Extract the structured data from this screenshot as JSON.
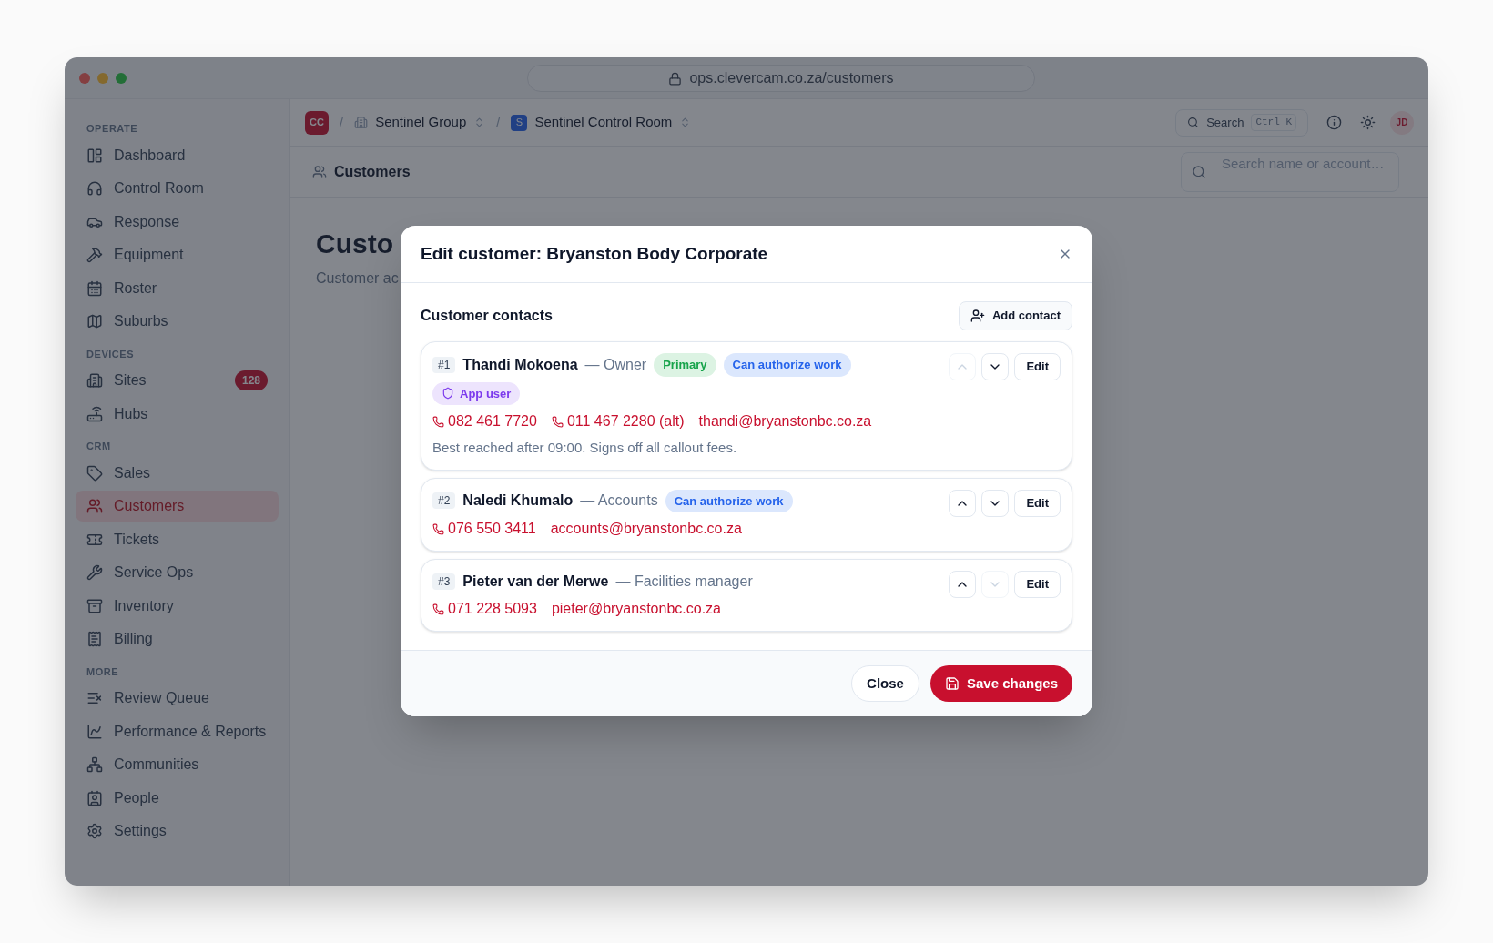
{
  "window": {
    "url": "ops.clevercam.co.za/customers"
  },
  "sidebar": {
    "sections": [
      {
        "title": "OPERATE",
        "items": [
          {
            "label": "Dashboard",
            "selected": false
          },
          {
            "label": "Control Room",
            "selected": false
          },
          {
            "label": "Response",
            "selected": false
          },
          {
            "label": "Equipment",
            "selected": false
          },
          {
            "label": "Roster",
            "selected": false
          },
          {
            "label": "Suburbs",
            "selected": false
          }
        ]
      },
      {
        "title": "DEVICES",
        "items": [
          {
            "label": "Sites",
            "badge": "128",
            "selected": false
          },
          {
            "label": "Hubs",
            "selected": false
          }
        ]
      },
      {
        "title": "CRM",
        "items": [
          {
            "label": "Sales",
            "selected": false
          },
          {
            "label": "Customers",
            "selected": true
          },
          {
            "label": "Tickets",
            "selected": false
          },
          {
            "label": "Service Ops",
            "selected": false
          },
          {
            "label": "Inventory",
            "selected": false
          },
          {
            "label": "Billing",
            "selected": false
          }
        ]
      },
      {
        "title": "MORE",
        "items": [
          {
            "label": "Review Queue",
            "selected": false
          },
          {
            "label": "Performance & Reports",
            "selected": false
          },
          {
            "label": "Communities",
            "selected": false
          },
          {
            "label": "People",
            "selected": false
          },
          {
            "label": "Settings",
            "selected": false
          }
        ]
      }
    ]
  },
  "topbar": {
    "org_badge": "CC",
    "separators": [
      "/",
      "/"
    ],
    "group": "Sentinel Group",
    "room_badge": "S",
    "room": "Sentinel Control Room",
    "search": {
      "label": "Search",
      "shortcut": "Ctrl K"
    },
    "avatar": "JD"
  },
  "subheader": {
    "title": "Customers",
    "search": {
      "placeholder": "Search name or account…"
    }
  },
  "page": {
    "heading": "Custo",
    "subtitle": "Customer ac"
  },
  "modal": {
    "title": "Edit customer: Bryanston Body Corporate",
    "section_title": "Customer contacts",
    "add_button": "Add contact",
    "contacts": [
      {
        "number": "#1",
        "name": "Thandi Mokoena",
        "role": "— Owner",
        "tags": [
          {
            "label": "Primary",
            "kind": "primary"
          },
          {
            "label": "Can authorize work",
            "kind": "authorize"
          }
        ],
        "extra_tags": [
          {
            "label": "App user",
            "kind": "app_user"
          }
        ],
        "phones": [
          "082 461 7720",
          "011 467 2280 (alt)"
        ],
        "email": "thandi@bryanstonbc.co.za",
        "note": "Best reached after 09:00. Signs off all callout fees.",
        "up_disabled": true,
        "down_disabled": false,
        "edit": "Edit"
      },
      {
        "number": "#2",
        "name": "Naledi Khumalo",
        "role": "— Accounts",
        "tags": [
          {
            "label": "Can authorize work",
            "kind": "authorize"
          }
        ],
        "phones": [
          "076 550 3411"
        ],
        "email": "accounts@bryanstonbc.co.za",
        "up_disabled": false,
        "down_disabled": false,
        "edit": "Edit"
      },
      {
        "number": "#3",
        "name": "Pieter van der Merwe",
        "role": "— Facilities manager",
        "phones": [
          "071 228 5093"
        ],
        "email": "pieter@bryanstonbc.co.za",
        "up_disabled": false,
        "down_disabled": true,
        "edit": "Edit"
      }
    ],
    "close_button": "Close",
    "save_button": "Save changes"
  }
}
